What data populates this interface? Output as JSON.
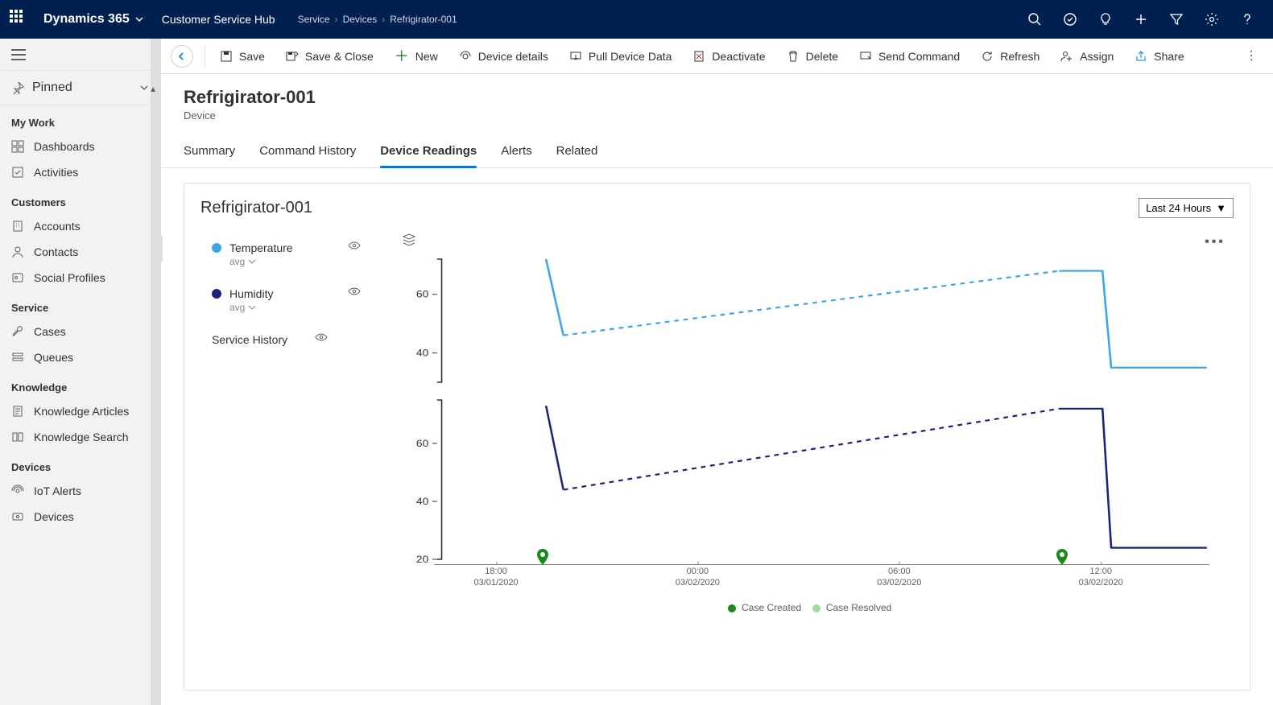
{
  "topnav": {
    "app_name": "Dynamics 365",
    "hub_name": "Customer Service Hub",
    "breadcrumb": [
      "Service",
      "Devices",
      "Refrigirator-001"
    ]
  },
  "commandbar": {
    "save": "Save",
    "save_close": "Save & Close",
    "new": "New",
    "device_details": "Device details",
    "pull_data": "Pull Device Data",
    "deactivate": "Deactivate",
    "delete": "Delete",
    "send_command": "Send Command",
    "refresh": "Refresh",
    "assign": "Assign",
    "share": "Share"
  },
  "sidebar": {
    "pinned": "Pinned",
    "sections": {
      "my_work": "My Work",
      "customers": "Customers",
      "service": "Service",
      "knowledge": "Knowledge",
      "devices": "Devices"
    },
    "items": {
      "dashboards": "Dashboards",
      "activities": "Activities",
      "accounts": "Accounts",
      "contacts": "Contacts",
      "social_profiles": "Social Profiles",
      "cases": "Cases",
      "queues": "Queues",
      "knowledge_articles": "Knowledge Articles",
      "knowledge_search": "Knowledge Search",
      "iot_alerts": "IoT Alerts",
      "devices": "Devices"
    }
  },
  "record": {
    "title": "Refrigirator-001",
    "entity": "Device"
  },
  "tabs": {
    "summary": "Summary",
    "command_history": "Command History",
    "device_readings": "Device Readings",
    "alerts": "Alerts",
    "related": "Related"
  },
  "card": {
    "title": "Refrigirator-001",
    "time_range": "Last 24 Hours",
    "legend": {
      "temperature": "Temperature",
      "humidity": "Humidity",
      "avg": "avg",
      "service_history": "Service History"
    },
    "bottom_legend": {
      "case_created": "Case Created",
      "case_resolved": "Case Resolved"
    },
    "colors": {
      "temperature": "#3ca6e8",
      "humidity": "#1a237e",
      "case_created": "#1a8a1a",
      "case_resolved": "#a6d8a6"
    }
  },
  "chart_data": [
    {
      "type": "line",
      "name": "Temperature",
      "color": "#3ca6e8",
      "ylabel": "",
      "ylim": [
        30,
        72
      ],
      "yticks": [
        40,
        60
      ],
      "x_range": [
        "2020-03-01T17:00",
        "2020-03-02T15:00"
      ],
      "segments": [
        {
          "style": "solid",
          "points": [
            {
              "t": "2020-03-01T20:00",
              "v": 72
            },
            {
              "t": "2020-03-01T20:30",
              "v": 46
            }
          ]
        },
        {
          "style": "dashed",
          "points": [
            {
              "t": "2020-03-01T20:30",
              "v": 46
            },
            {
              "t": "2020-03-02T10:45",
              "v": 68
            }
          ]
        },
        {
          "style": "solid",
          "points": [
            {
              "t": "2020-03-02T10:45",
              "v": 68
            },
            {
              "t": "2020-03-02T12:00",
              "v": 68
            },
            {
              "t": "2020-03-02T12:15",
              "v": 35
            },
            {
              "t": "2020-03-02T15:00",
              "v": 35
            }
          ]
        }
      ]
    },
    {
      "type": "line",
      "name": "Humidity",
      "color": "#1a237e",
      "ylabel": "",
      "ylim": [
        20,
        75
      ],
      "yticks": [
        20,
        40,
        60
      ],
      "x_range": [
        "2020-03-01T17:00",
        "2020-03-02T15:00"
      ],
      "segments": [
        {
          "style": "solid",
          "points": [
            {
              "t": "2020-03-01T20:00",
              "v": 73
            },
            {
              "t": "2020-03-01T20:30",
              "v": 44
            }
          ]
        },
        {
          "style": "dashed",
          "points": [
            {
              "t": "2020-03-01T20:30",
              "v": 44
            },
            {
              "t": "2020-03-02T10:45",
              "v": 72
            }
          ]
        },
        {
          "style": "solid",
          "points": [
            {
              "t": "2020-03-02T10:45",
              "v": 72
            },
            {
              "t": "2020-03-02T12:00",
              "v": 72
            },
            {
              "t": "2020-03-02T12:15",
              "v": 24
            },
            {
              "t": "2020-03-02T15:00",
              "v": 24
            }
          ]
        }
      ]
    }
  ],
  "xaxis": {
    "ticks": [
      {
        "time": "18:00",
        "date": "03/01/2020",
        "pos": 8
      },
      {
        "time": "00:00",
        "date": "03/02/2020",
        "pos": 34
      },
      {
        "time": "06:00",
        "date": "03/02/2020",
        "pos": 60
      },
      {
        "time": "12:00",
        "date": "03/02/2020",
        "pos": 86
      }
    ]
  },
  "event_markers": [
    {
      "type": "case_created",
      "pos": 14
    },
    {
      "type": "case_created",
      "pos": 81
    }
  ]
}
